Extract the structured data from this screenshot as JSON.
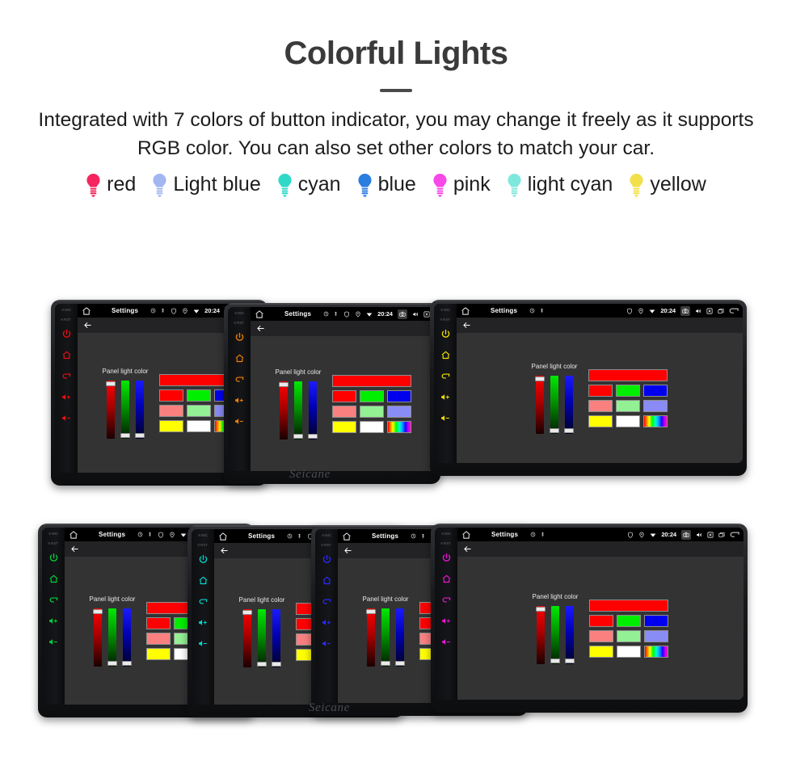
{
  "header": {
    "title": "Colorful Lights",
    "subtitle": "Integrated with 7 colors of button indicator, you may change it freely as it supports RGB color. You can also set other colors to match your car."
  },
  "legend": {
    "items": [
      {
        "label": "red",
        "icon": "bulb-icon",
        "color": "#f4255f"
      },
      {
        "label": "Light blue",
        "icon": "bulb-icon",
        "color": "#a3b6f2"
      },
      {
        "label": "cyan",
        "icon": "bulb-icon",
        "color": "#2ed9c7"
      },
      {
        "label": "blue",
        "icon": "bulb-icon",
        "color": "#2a7de1"
      },
      {
        "label": "pink",
        "icon": "bulb-icon",
        "color": "#f748e8"
      },
      {
        "label": "light cyan",
        "icon": "bulb-icon",
        "color": "#7fe8dd"
      },
      {
        "label": "yellow",
        "icon": "bulb-icon",
        "color": "#f2e04a"
      }
    ]
  },
  "device": {
    "brand": "Seicane",
    "statusbar": {
      "home_icon": "home-icon",
      "title": "Settings",
      "mini_icons": [
        "clock-icon",
        "gps-icon"
      ],
      "right_icons": [
        "shield-icon",
        "location-pin-icon",
        "wifi-icon"
      ],
      "clock": "20:24",
      "camera_icon": "camera-icon",
      "volume_icon": "volume-icon",
      "close_icon": "close-box-icon",
      "recents_icon": "recents-icon",
      "back_icon": "back-arrow-icon"
    },
    "actionbar": {
      "back_icon": "back-arrow-icon"
    },
    "panel": {
      "title": "Panel light color",
      "sliders": [
        {
          "name": "red",
          "value": 100
        },
        {
          "name": "green",
          "value": 0
        },
        {
          "name": "blue",
          "value": 0
        }
      ],
      "preview_color": "#ff0000",
      "swatch_rows": [
        [
          "#ff0000",
          "#00ee00",
          "#0000ee"
        ],
        [
          "#fa8080",
          "#94f094",
          "#8a8cf5"
        ],
        [
          "#ffff00",
          "#ffffff",
          "rainbow"
        ]
      ]
    },
    "side_buttons": {
      "mic_label": "MIC",
      "rst_label": "RST",
      "icons": [
        "power-icon",
        "home-icon",
        "back-icon",
        "volume-up-icon",
        "volume-down-icon"
      ]
    },
    "units": [
      {
        "id": "unit-1",
        "button_color": "#e81010",
        "row": "top"
      },
      {
        "id": "unit-2",
        "button_color": "#f08000",
        "row": "top"
      },
      {
        "id": "unit-3",
        "button_color": "#f2e000",
        "row": "top"
      },
      {
        "id": "unit-4",
        "button_color": "#00d43c",
        "row": "bottom"
      },
      {
        "id": "unit-5",
        "button_color": "#00d8d0",
        "row": "bottom"
      },
      {
        "id": "unit-6",
        "button_color": "#2a2aff",
        "row": "bottom"
      },
      {
        "id": "unit-7",
        "button_color": "#ec16d8",
        "row": "bottom"
      }
    ]
  }
}
